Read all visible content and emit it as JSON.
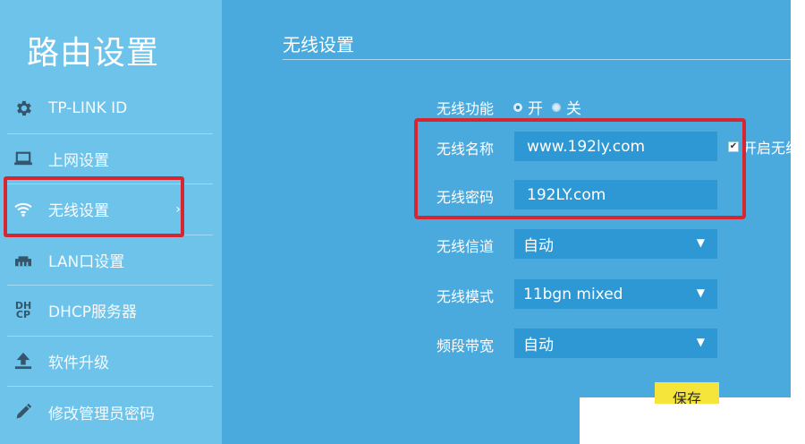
{
  "sidebar": {
    "title": "路由设置",
    "items": [
      {
        "label": "TP-LINK ID",
        "icon": "gear-icon"
      },
      {
        "label": "上网设置",
        "icon": "laptop-icon"
      },
      {
        "label": "无线设置",
        "icon": "wifi-icon",
        "active": true
      },
      {
        "label": "LAN口设置",
        "icon": "lan-icon"
      },
      {
        "label": "DHCP服务器",
        "icon": "dhcp-icon",
        "icon_text": "DH\nCP"
      },
      {
        "label": "软件升级",
        "icon": "upload-icon"
      },
      {
        "label": "修改管理员密码",
        "icon": "pencil-icon"
      }
    ],
    "active_chevron": "›"
  },
  "main": {
    "title": "无线设置",
    "wireless_function": {
      "label": "无线功能",
      "options": [
        {
          "label": "开",
          "checked": true
        },
        {
          "label": "关",
          "checked": false
        }
      ]
    },
    "ssid": {
      "label": "无线名称",
      "value": "www.192ly.com"
    },
    "ssid_checkbox": {
      "label": "开启无线",
      "checked": true
    },
    "password": {
      "label": "无线密码",
      "value": "192LY.com"
    },
    "channel": {
      "label": "无线信道",
      "value": "自动"
    },
    "mode": {
      "label": "无线模式",
      "value": "11bgn mixed"
    },
    "bandwidth": {
      "label": "频段带宽",
      "value": "自动"
    },
    "save_label": "保存"
  },
  "colors": {
    "background": "#4aa9dd",
    "sidebar": "#6ec3ea",
    "field": "#2d98d4",
    "highlight": "#d6262f",
    "save_button": "#f5e43a"
  }
}
